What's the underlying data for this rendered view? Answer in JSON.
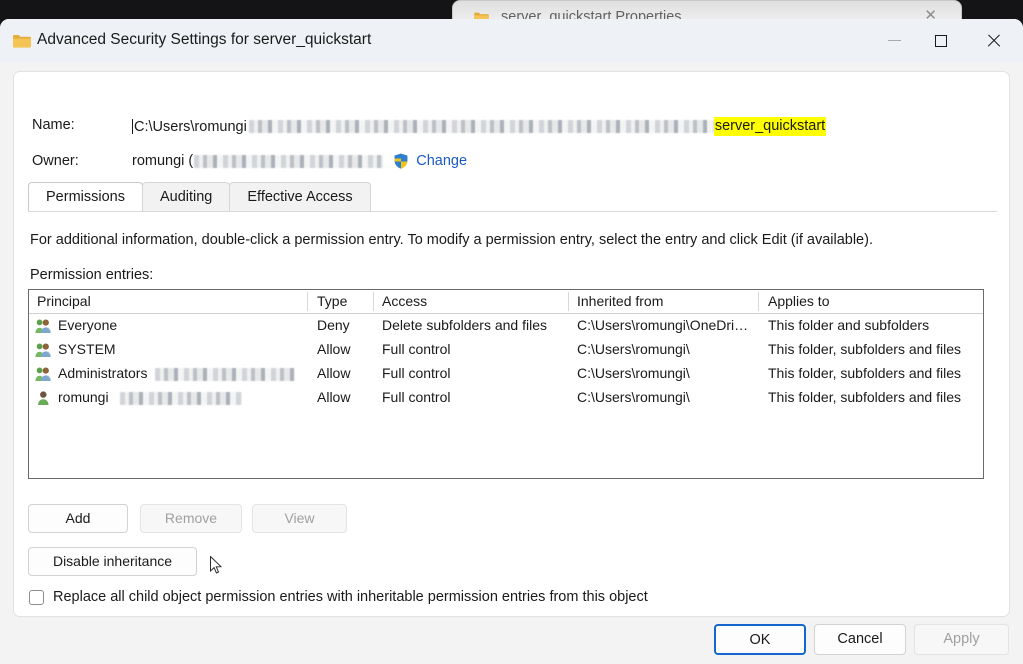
{
  "background_window": {
    "title": "server_quickstart Properties",
    "icon": "folder-icon",
    "close_label": "✕"
  },
  "window": {
    "title": "Advanced Security Settings for server_quickstart",
    "icon": "folder-icon",
    "controls": {
      "minimize": "—",
      "maximize": "□",
      "close": "✕"
    }
  },
  "header": {
    "name_label": "Name:",
    "name_value_prefix": "C:\\Users\\romungi",
    "name_value_highlight": "server_quickstart",
    "owner_label": "Owner:",
    "owner_value": "romungi (",
    "change_link": "Change",
    "shield_icon": "uac-shield-icon"
  },
  "tabs": [
    {
      "label": "Permissions",
      "active": true
    },
    {
      "label": "Auditing",
      "active": false
    },
    {
      "label": "Effective Access",
      "active": false
    }
  ],
  "main": {
    "info_text": "For additional information, double-click a permission entry. To modify a permission entry, select the entry and click Edit (if available).",
    "entries_label": "Permission entries:"
  },
  "table": {
    "columns": [
      "Principal",
      "Type",
      "Access",
      "Inherited from",
      "Applies to"
    ],
    "rows": [
      {
        "icon": "group-icon",
        "principal": "Everyone",
        "principal_redacted": false,
        "type": "Deny",
        "access": "Delete subfolders and files",
        "inherited_from": "C:\\Users\\romungi\\OneDri…",
        "applies_to": "This folder and subfolders"
      },
      {
        "icon": "group-icon",
        "principal": "SYSTEM",
        "principal_redacted": false,
        "type": "Allow",
        "access": "Full control",
        "inherited_from": "C:\\Users\\romungi\\",
        "applies_to": "This folder, subfolders and files"
      },
      {
        "icon": "group-icon",
        "principal": "Administrators",
        "principal_redacted": true,
        "type": "Allow",
        "access": "Full control",
        "inherited_from": "C:\\Users\\romungi\\",
        "applies_to": "This folder, subfolders and files"
      },
      {
        "icon": "user-icon",
        "principal": "romungi",
        "principal_redacted": true,
        "type": "Allow",
        "access": "Full control",
        "inherited_from": "C:\\Users\\romungi\\",
        "applies_to": "This folder, subfolders and files"
      }
    ]
  },
  "actions": {
    "add": "Add",
    "remove": "Remove",
    "view": "View",
    "disable_inheritance": "Disable inheritance",
    "remove_enabled": false,
    "view_enabled": false
  },
  "checkbox": {
    "label": "Replace all child object permission entries with inheritable permission entries from this object",
    "checked": false
  },
  "footer": {
    "ok": "OK",
    "cancel": "Cancel",
    "apply": "Apply",
    "apply_enabled": false
  },
  "colors": {
    "accent": "#1367cf",
    "link": "#1b59c4",
    "highlight": "#ffff00",
    "titlebar": "#eef2f6",
    "dialog_bg": "#f3f3f3"
  }
}
